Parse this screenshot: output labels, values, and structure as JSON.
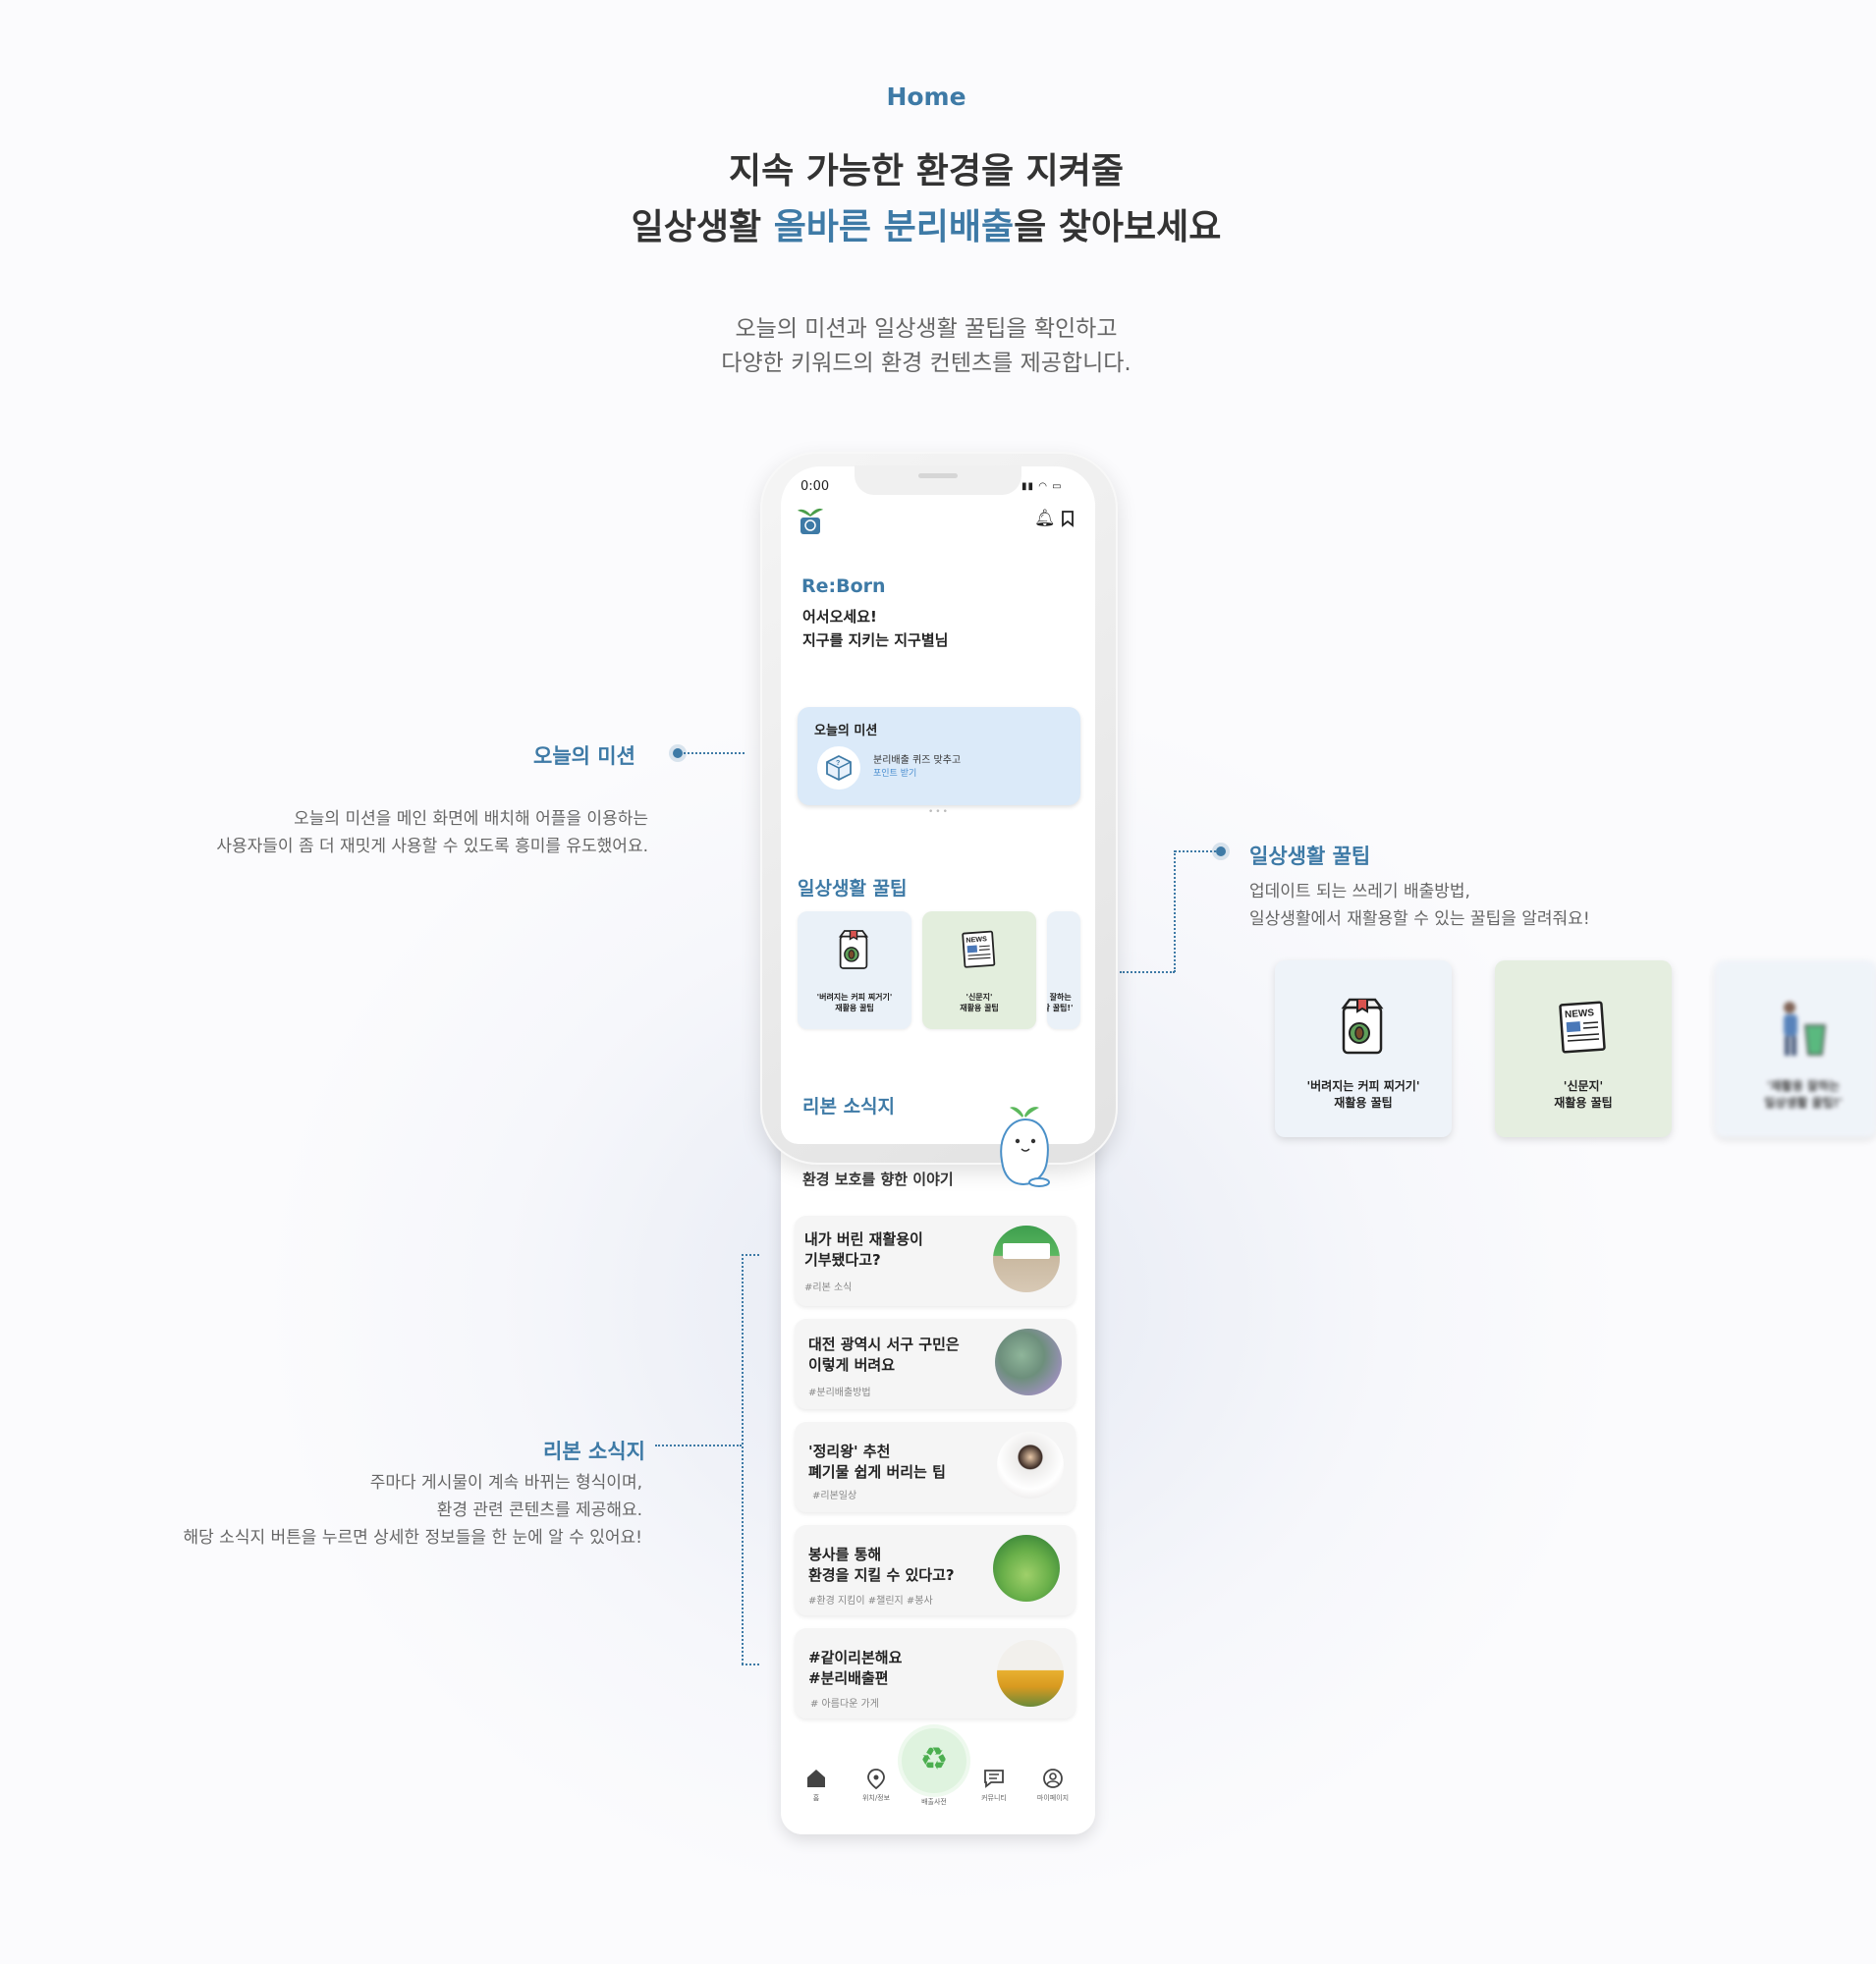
{
  "header": {
    "eyebrow": "Home",
    "headline_line1": "지속 가능한 환경을 지켜줄",
    "headline_line2_pre": "일상생활 ",
    "headline_line2_accent": "올바른 분리배출",
    "headline_line2_post": "을 찾아보세요",
    "sub_line1": "오늘의 미션과 일상생활 꿀팁을 확인하고",
    "sub_line2": "다양한 키워드의 환경 컨텐츠를 제공합니다."
  },
  "annotations": {
    "mission": {
      "title": "오늘의 미션",
      "desc_line1": "오늘의 미션을 메인 화면에 배치해 어플을 이용하는",
      "desc_line2": "사용자들이 좀 더 재밋게 사용할 수 있도록 흥미를 유도했어요."
    },
    "tips": {
      "title": "일상생활 꿀팁",
      "desc_line1": "업데이트 되는 쓰레기 배출방법,",
      "desc_line2": "일상생활에서  재활용할 수 있는 꿀팁을 알려줘요!"
    },
    "news": {
      "title": "리본 소식지",
      "desc_line1": "주마다 게시물이 계속 바뀌는 형식이며,",
      "desc_line2": "환경 관련 콘텐츠를 제공해요.",
      "desc_line3": "해당 소식지 버튼을 누르면 상세한 정보들을 한 눈에 알 수 있어요!"
    }
  },
  "phone": {
    "status_time": "0:00",
    "brand": "Re:Born",
    "greeting_line1": "어서오세요!",
    "greeting_line2": "지구를 지키는 지구별님",
    "mission": {
      "title": "오늘의 미션",
      "line1": "분리배출 퀴즈 맞추고",
      "line2": "포인트 받기"
    },
    "tips_title": "일상생활 꿀팁",
    "tips": [
      {
        "line1": "'버려지는 커피 찌거기'",
        "line2": "재활용 꿀팁",
        "bg": "#eaf1f8"
      },
      {
        "line1": "'신문지'",
        "line2": "재활용  꿀팁",
        "bg": "#e3eedd"
      },
      {
        "line1": "'재활용 잘하는",
        "line2": "일상생활 꿀팁!'",
        "bg": "#eaf1f8"
      }
    ],
    "news_title": "리본 소식지",
    "news_subtitle": "환경 보호를 향한 이야기",
    "news": [
      {
        "line1": "내가 버린 재활용이",
        "line2": "기부됐다고?",
        "tag": "#리본 소식"
      },
      {
        "line1": "대전 광역시 서구 구민은",
        "line2": "이렇게 버려요",
        "tag": "#분리배출방법"
      },
      {
        "line1": "'정리왕' 추천",
        "line2": " 폐기물 쉽게 버리는 팁",
        "tag": "#리본일상"
      },
      {
        "line1": "봉사를 통해",
        "line2": "환경을 지킬 수 있다고?",
        "tag": "#환경 지킴이 #챌린지  #봉사"
      },
      {
        "line1": "#같이리본해요",
        "line2": "#분리배출편",
        "tag": "# 아름다운 가게"
      }
    ],
    "nav": [
      {
        "label": "홈",
        "icon": "home-icon"
      },
      {
        "label": "위치/정보",
        "icon": "location-pin-icon"
      },
      {
        "label": "배출사전",
        "icon": "recycle-icon"
      },
      {
        "label": "커뮤니티",
        "icon": "community-icon"
      },
      {
        "label": "마이페이지",
        "icon": "profile-icon"
      }
    ]
  },
  "tip_showcase": [
    {
      "line1": "'버려지는 커피 찌거기'",
      "line2": "재활용 꿀팁",
      "bg": "#eef3f9"
    },
    {
      "line1": "'신문지'",
      "line2": "재활용 꿀팁",
      "bg": "#e5eee0"
    },
    {
      "line1": "'재활용 잘하는",
      "line2": "일상생활 꿀팁!'",
      "bg": "#eef3f9"
    }
  ],
  "colors": {
    "accent": "#3e7aa6",
    "mission_bg": "#dbeaf9",
    "recycle_green": "#5cb85c"
  }
}
